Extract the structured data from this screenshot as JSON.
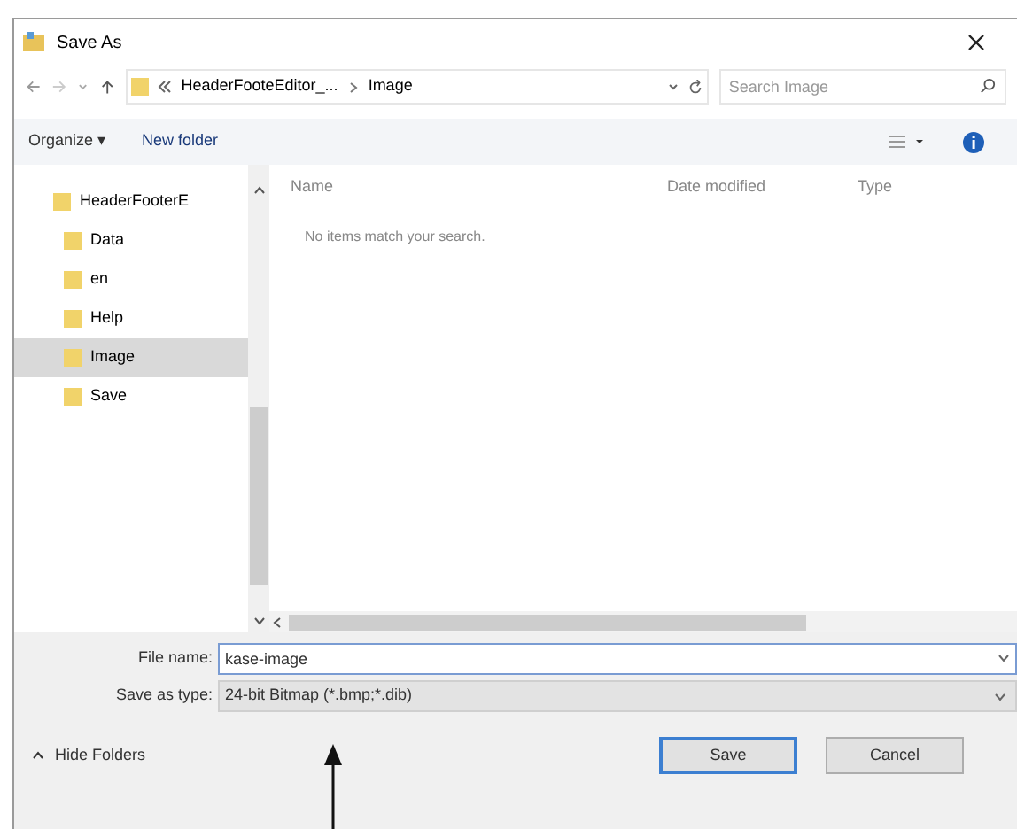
{
  "window": {
    "title": "Save As"
  },
  "address_bar": {
    "path": [
      "HeaderFooteEditor_...",
      "Image"
    ],
    "search": {
      "placeholder": "Search Image"
    }
  },
  "toolbar": {
    "buttons": [
      "Organize ▾",
      "New folder"
    ]
  },
  "navigation": {
    "items": [
      {
        "label": "HeaderFooterE",
        "selected": false,
        "children": [
          {
            "label": "Data",
            "selected": false
          },
          {
            "label": "en",
            "selected": false
          },
          {
            "label": "Help",
            "selected": false
          },
          {
            "label": "Image",
            "selected": true
          },
          {
            "label": "Save",
            "selected": false
          }
        ]
      }
    ]
  },
  "file_list": {
    "columns": [
      "Name",
      "Date modified",
      "Type"
    ],
    "empty_message": "No items match your search."
  },
  "form": {
    "fields": [
      {
        "label": "File name:",
        "value": "kase-image",
        "kind": "input"
      },
      {
        "label": "Save as type:",
        "value": "24-bit Bitmap (*.bmp;*.dib)",
        "kind": "select"
      }
    ]
  },
  "footer": {
    "hide_folders": "Hide Folders",
    "buttons": [
      {
        "label": "Save",
        "selected": true
      },
      {
        "label": "Cancel",
        "selected": false
      }
    ]
  }
}
